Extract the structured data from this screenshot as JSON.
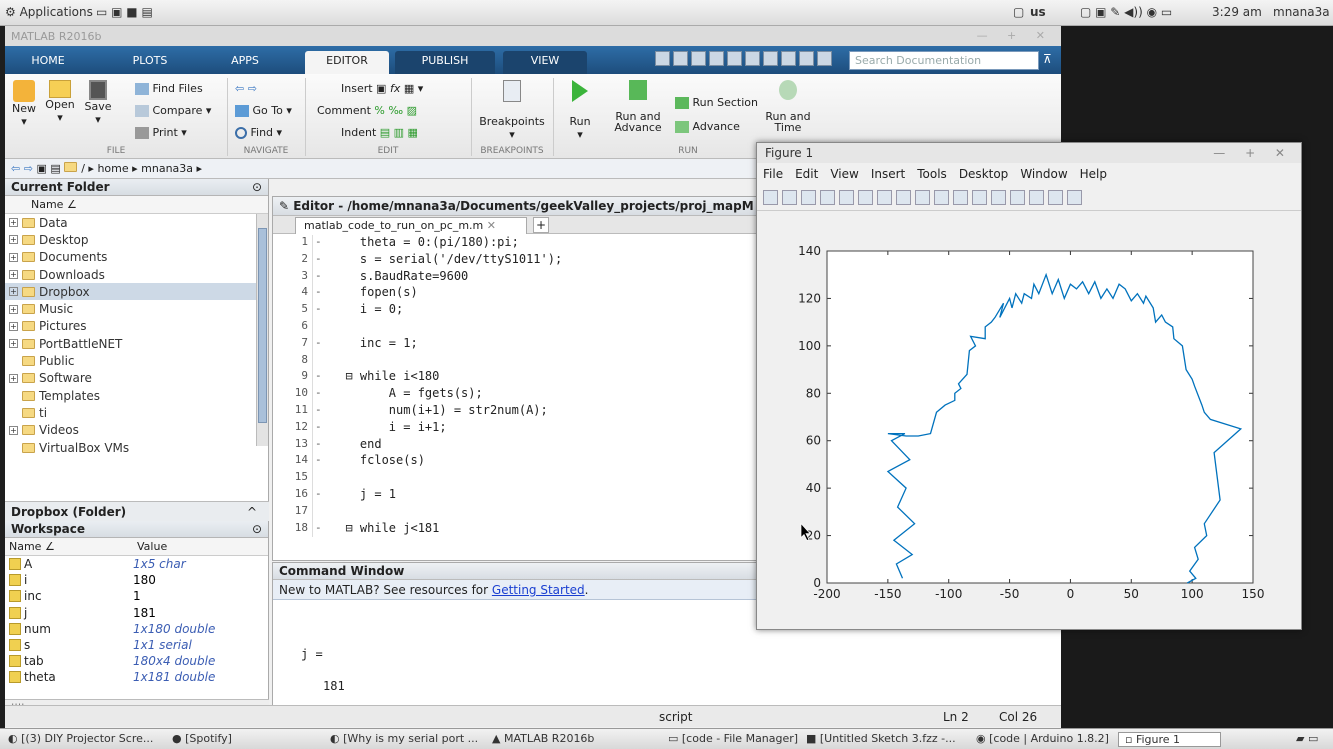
{
  "topbar": {
    "apps": "Applications",
    "kbd": "us",
    "clock": "3:29 am",
    "user": "mnana3a"
  },
  "window": {
    "title": "MATLAB R2016b"
  },
  "tabs": [
    "HOME",
    "PLOTS",
    "APPS",
    "EDITOR",
    "PUBLISH",
    "VIEW"
  ],
  "search": {
    "placeholder": "Search Documentation"
  },
  "ribbon": {
    "new": "New",
    "open": "Open",
    "save": "Save",
    "find_files": "Find Files",
    "compare": "Compare",
    "print": "Print",
    "go_to": "Go To",
    "find": "Find",
    "insert": "Insert",
    "comment": "Comment",
    "indent": "Indent",
    "breakpoints": "Breakpoints",
    "run": "Run",
    "run_advance": "Run and Advance",
    "run_section": "Run Section",
    "advance": "Advance",
    "run_time": "Run and Time",
    "sections": {
      "file": "FILE",
      "navigate": "NAVIGATE",
      "edit": "EDIT",
      "breakpoints": "BREAKPOINTS",
      "run": "RUN"
    }
  },
  "address": "/ ▸ home ▸ mnana3a ▸",
  "current_folder": {
    "title": "Current Folder",
    "col": "Name ∠",
    "items": [
      {
        "name": "Data",
        "exp": "+"
      },
      {
        "name": "Desktop",
        "exp": "+"
      },
      {
        "name": "Documents",
        "exp": "+"
      },
      {
        "name": "Downloads",
        "exp": "+"
      },
      {
        "name": "Dropbox",
        "exp": "+"
      },
      {
        "name": "Music",
        "exp": "+"
      },
      {
        "name": "Pictures",
        "exp": "+"
      },
      {
        "name": "PortBattleNET",
        "exp": "+"
      },
      {
        "name": "Public",
        "exp": ""
      },
      {
        "name": "Software",
        "exp": "+"
      },
      {
        "name": "Templates",
        "exp": ""
      },
      {
        "name": "ti",
        "exp": ""
      },
      {
        "name": "Videos",
        "exp": "+"
      },
      {
        "name": "VirtualBox VMs",
        "exp": ""
      }
    ]
  },
  "details": "Dropbox (Folder)",
  "workspace": {
    "title": "Workspace",
    "col_name": "Name ∠",
    "col_value": "Value",
    "rows": [
      {
        "name": "A",
        "value": "1x5 char",
        "it": true
      },
      {
        "name": "i",
        "value": "180",
        "it": false
      },
      {
        "name": "inc",
        "value": "1",
        "it": false
      },
      {
        "name": "j",
        "value": "181",
        "it": false
      },
      {
        "name": "num",
        "value": "1x180 double",
        "it": true
      },
      {
        "name": "s",
        "value": "1x1 serial",
        "it": true
      },
      {
        "name": "tab",
        "value": "180x4 double",
        "it": true
      },
      {
        "name": "theta",
        "value": "1x181 double",
        "it": true
      }
    ]
  },
  "editor": {
    "header": "Editor - /home/mnana3a/Documents/geekValley_projects/proj_mapM",
    "tab": "matlab_code_to_run_on_pc_m.m",
    "lines": [
      {
        "n": "1",
        "d": "-",
        "c": "    theta = 0:(pi/180):pi;"
      },
      {
        "n": "2",
        "d": "-",
        "c": "    s = serial('/dev/ttyS1011');"
      },
      {
        "n": "3",
        "d": "-",
        "c": "    s.BaudRate=9600"
      },
      {
        "n": "4",
        "d": "-",
        "c": "    fopen(s)"
      },
      {
        "n": "5",
        "d": "-",
        "c": "    i = 0;"
      },
      {
        "n": "6",
        "d": "",
        "c": ""
      },
      {
        "n": "7",
        "d": "-",
        "c": "    inc = 1;"
      },
      {
        "n": "8",
        "d": "",
        "c": ""
      },
      {
        "n": "9",
        "d": "-",
        "c": "  ⊟ while i<180"
      },
      {
        "n": "10",
        "d": "-",
        "c": "        A = fgets(s);"
      },
      {
        "n": "11",
        "d": "-",
        "c": "        num(i+1) = str2num(A);"
      },
      {
        "n": "12",
        "d": "-",
        "c": "        i = i+1;"
      },
      {
        "n": "13",
        "d": "-",
        "c": "    end"
      },
      {
        "n": "14",
        "d": "-",
        "c": "    fclose(s)"
      },
      {
        "n": "15",
        "d": "",
        "c": ""
      },
      {
        "n": "16",
        "d": "-",
        "c": "    j = 1"
      },
      {
        "n": "17",
        "d": "",
        "c": ""
      },
      {
        "n": "18",
        "d": "-",
        "c": "  ⊟ while j<181"
      }
    ]
  },
  "command": {
    "title": "Command Window",
    "new_text": "New to MATLAB? See resources for ",
    "link": "Getting Started",
    "link_end": ".",
    "out1": "j =",
    "out2": "181",
    "prompt": ">>"
  },
  "status": {
    "script": "script",
    "ln": "Ln  2",
    "col": "Col  26"
  },
  "figure": {
    "title": "Figure 1",
    "menu": [
      "File",
      "Edit",
      "View",
      "Insert",
      "Tools",
      "Desktop",
      "Window",
      "Help"
    ]
  },
  "chart_data": {
    "type": "line",
    "xlim": [
      -200,
      150
    ],
    "ylim": [
      0,
      140
    ],
    "xticks": [
      -200,
      -150,
      -100,
      -50,
      0,
      50,
      100,
      150
    ],
    "yticks": [
      0,
      20,
      40,
      60,
      80,
      100,
      120,
      140
    ],
    "color": "#0072bd",
    "x": [
      -138,
      -143,
      -130,
      -145,
      -128,
      -142,
      -135,
      -150,
      -132,
      -147,
      -136,
      -150,
      -135,
      -125,
      -115,
      -110,
      -103,
      -95,
      -95,
      -90,
      -92,
      -85,
      -83,
      -78,
      -82,
      -70,
      -70,
      -65,
      -62,
      -55,
      -58,
      -50,
      -48,
      -45,
      -40,
      -38,
      -32,
      -30,
      -26,
      -20,
      -15,
      -10,
      -5,
      0,
      5,
      10,
      15,
      20,
      25,
      30,
      35,
      40,
      45,
      50,
      55,
      60,
      62,
      68,
      70,
      75,
      78,
      84,
      85,
      92,
      95,
      100,
      102,
      108,
      110,
      115,
      140,
      118,
      123,
      110,
      112,
      102,
      105,
      98,
      103,
      96
    ],
    "y": [
      2,
      8,
      12,
      18,
      25,
      32,
      40,
      47,
      52,
      60,
      63,
      63,
      62,
      62,
      63,
      72,
      75,
      77,
      80,
      82,
      84,
      88,
      98,
      100,
      104,
      103,
      108,
      110,
      112,
      118,
      112,
      120,
      116,
      122,
      118,
      122,
      120,
      126,
      122,
      130,
      122,
      128,
      120,
      126,
      124,
      127,
      122,
      127,
      120,
      124,
      120,
      126,
      124,
      119,
      122,
      118,
      121,
      116,
      110,
      113,
      110,
      108,
      103,
      100,
      90,
      86,
      83,
      75,
      72,
      69,
      65,
      55,
      35,
      25,
      20,
      15,
      10,
      5,
      2,
      0
    ]
  },
  "taskbar": [
    "[(3) DIY Projector Scre...",
    "[Spotify]",
    "[Why is my serial port ...",
    "MATLAB R2016b",
    "[code - File Manager]",
    "[Untitled Sketch 3.fzz -...",
    "[code | Arduino 1.8.2]",
    "Figure 1"
  ]
}
